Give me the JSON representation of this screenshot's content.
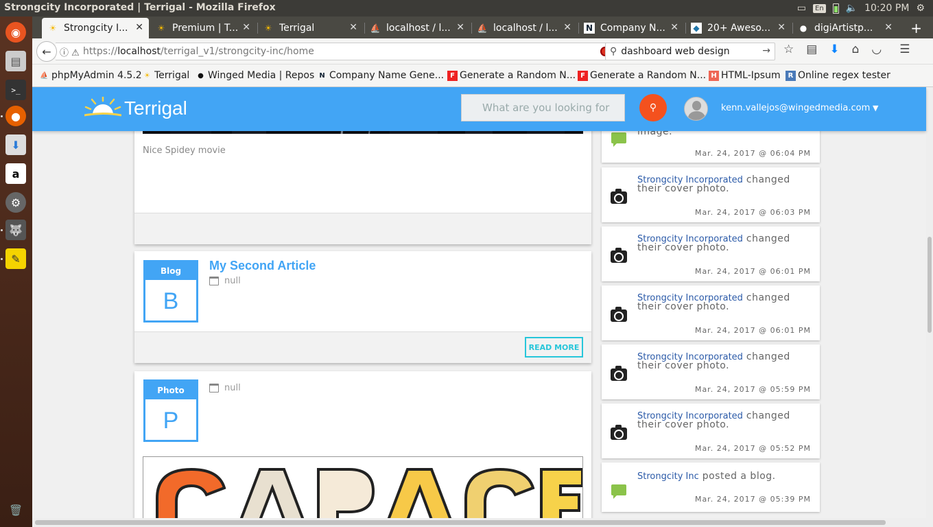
{
  "window": {
    "title": "Strongcity Incorporated | Terrigal - Mozilla Firefox"
  },
  "system": {
    "keyboard": "En",
    "time": "10:20 PM"
  },
  "tabs": [
    {
      "label": "Strongcity I..."
    },
    {
      "label": "Premium | T..."
    },
    {
      "label": "Terrigal"
    },
    {
      "label": "localhost / l..."
    },
    {
      "label": "localhost / l..."
    },
    {
      "label": "Company N..."
    },
    {
      "label": "20+ Aweso..."
    },
    {
      "label": "digiArtistp..."
    }
  ],
  "nav": {
    "url_prefix": "https://",
    "url_host": "localhost",
    "url_path": "/terrigal_v1/strongcity-inc/home",
    "search_value": "dashboard web design"
  },
  "bookmarks": [
    {
      "label": "phpMyAdmin 4.5.2"
    },
    {
      "label": "Terrigal"
    },
    {
      "label": "Winged Media | Repos"
    },
    {
      "label": "Company Name Gene..."
    },
    {
      "label": "Generate a Random N..."
    },
    {
      "label": "Generate a Random N..."
    },
    {
      "label": "HTML-Ipsum"
    },
    {
      "label": "Online regex tester"
    }
  ],
  "header": {
    "logo_text": "Terrigal",
    "search_placeholder": "What are you looking for",
    "user_email": "kenn.vallejos@wingedmedia.com"
  },
  "posts": [
    {
      "caption": "Nice Spidey movie"
    },
    {
      "tag": "Blog",
      "letter": "B",
      "title": "My Second Article",
      "date": "null",
      "action": "READ MORE"
    },
    {
      "tag": "Photo",
      "letter": "P",
      "date": "null"
    }
  ],
  "feed": [
    {
      "icon": "chat",
      "text": "image.",
      "time": "Mar. 24, 2017 @ 06:04 PM"
    },
    {
      "icon": "camera",
      "who": "Strongcity Incorporated",
      "text": " changed their cover photo.",
      "time": "Mar. 24, 2017 @ 06:03 PM"
    },
    {
      "icon": "camera",
      "who": "Strongcity Incorporated",
      "text": " changed their cover photo.",
      "time": "Mar. 24, 2017 @ 06:01 PM"
    },
    {
      "icon": "camera",
      "who": "Strongcity Incorporated",
      "text": " changed their cover photo.",
      "time": "Mar. 24, 2017 @ 06:01 PM"
    },
    {
      "icon": "camera",
      "who": "Strongcity Incorporated",
      "text": " changed their cover photo.",
      "time": "Mar. 24, 2017 @ 05:59 PM"
    },
    {
      "icon": "camera",
      "who": "Strongcity Incorporated",
      "text": " changed their cover photo.",
      "time": "Mar. 24, 2017 @ 05:52 PM"
    },
    {
      "icon": "chat",
      "who": "Strongcity Inc",
      "text": " posted a blog.",
      "time": "Mar. 24, 2017 @ 05:39 PM"
    }
  ],
  "colors": {
    "accent": "#42a5f5",
    "search_button": "#f4511e",
    "read_more": "#26c6da",
    "link": "#2b5aa8"
  }
}
